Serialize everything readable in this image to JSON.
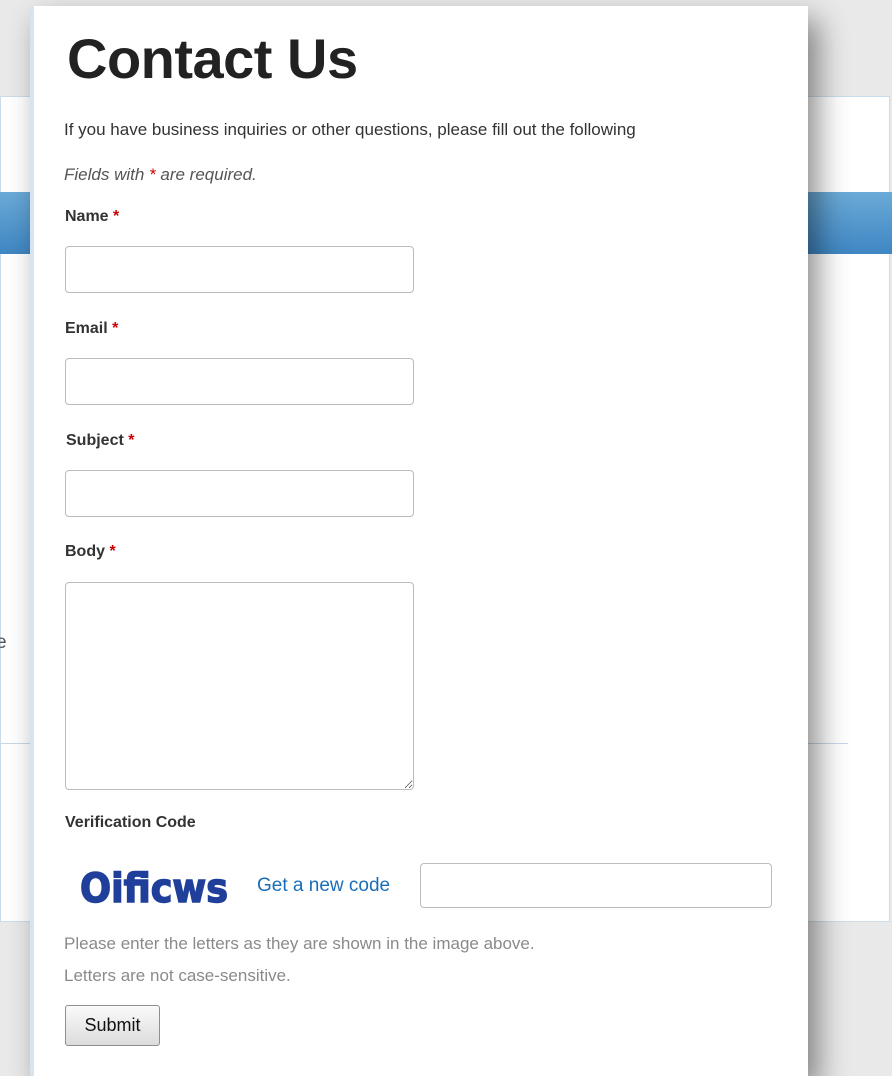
{
  "page": {
    "title": "Contact Us",
    "intro": "If you have business inquiries or other questions, please fill out the following",
    "note_prefix": "Fields with ",
    "note_asterisk": "*",
    "note_suffix": " are required.",
    "background_fragment": "e"
  },
  "form": {
    "name_label": "Name",
    "email_label": "Email",
    "subject_label": "Subject",
    "body_label": "Body",
    "required_mark": "*",
    "name_value": "",
    "email_value": "",
    "subject_value": "",
    "body_value": ""
  },
  "verification": {
    "label": "Verification Code",
    "captcha_text": "Oificws",
    "new_code_link": "Get a new code",
    "input_value": "",
    "hint_line1": "Please enter the letters as they are shown in the image above.",
    "hint_line2": "Letters are not case-sensitive."
  },
  "actions": {
    "submit_label": "Submit"
  },
  "colors": {
    "required": "#cc0000",
    "link": "#1a6db8",
    "captcha": "#1f3f9a",
    "header_band": "#4a90c8"
  }
}
